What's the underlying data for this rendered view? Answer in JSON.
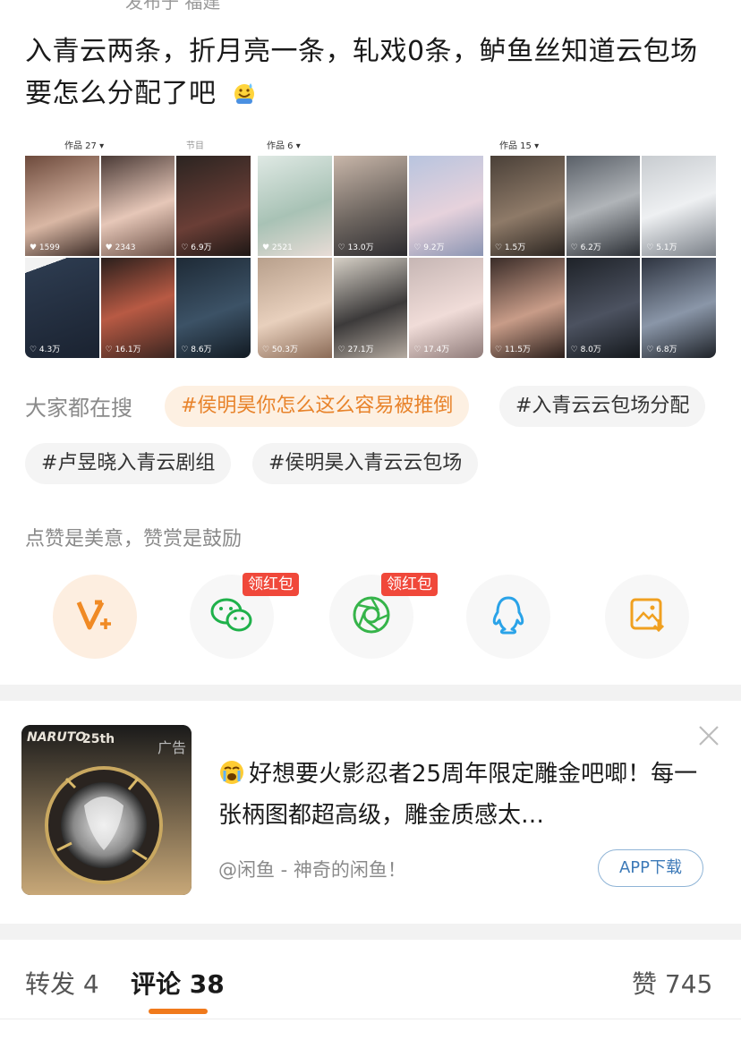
{
  "post": {
    "meta": "发布于 福建",
    "text": "入青云两条，折月亮一条，轧戏0条，鲈鱼丝知道云包场要怎么分配了吧",
    "emoji_icon": "sweat-smile-icon"
  },
  "thumbnails": [
    {
      "works": "作品 27 ▾",
      "tag": "节目",
      "counts": [
        "♥ 1599",
        "♥ 2343",
        "♡ 6.9万",
        "♡ 4.3万",
        "♡ 16.1万",
        "♡ 8.6万"
      ]
    },
    {
      "works": "作品 6 ▾",
      "tag": "",
      "counts": [
        "♥ 2521",
        "♡ 13.0万",
        "♡ 9.2万",
        "♡ 50.3万",
        "♡ 27.1万",
        "♡ 17.4万"
      ]
    },
    {
      "works": "作品 15 ▾",
      "tag": "",
      "counts": [
        "♡ 1.5万",
        "♡ 6.2万",
        "♡ 5.1万",
        "♡ 11.5万",
        "♡ 8.0万",
        "♡ 6.8万"
      ]
    }
  ],
  "search": {
    "label": "大家都在搜",
    "chips": [
      "#侯明昊你怎么这么容易被推倒",
      "#入青云云包场分配",
      "#卢昱晓入青云剧组",
      "#侯明昊入青云云包场"
    ]
  },
  "share": {
    "encourage": "点赞是美意，赞赏是鼓励",
    "red_packet": "领红包",
    "buttons": [
      "v-reward-icon",
      "wechat-icon",
      "moments-icon",
      "qq-icon",
      "save-image-icon"
    ]
  },
  "ad": {
    "tag": "广告",
    "emoji_icon": "crying-face-icon",
    "title": "好想要火影忍者25周年限定雕金吧唧！每一张柄图都超高级，雕金质感太…",
    "source": "@闲鱼 - 神奇的闲鱼！",
    "button": "APP下载",
    "image_text": "NARUTO",
    "image_badge": "25th"
  },
  "tabs": {
    "repost": "转发 4",
    "comment": "评论 38",
    "like": "赞 745"
  },
  "colors": {
    "accent": "#f07a1c",
    "hot_chip_text": "#e8832b",
    "red_tag": "#f0483a"
  }
}
